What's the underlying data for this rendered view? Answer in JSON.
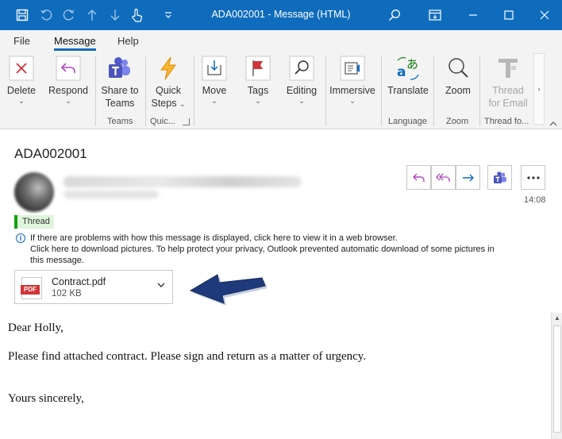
{
  "window": {
    "title": "ADA002001  -  Message (HTML)"
  },
  "menu": {
    "tabs": [
      {
        "label": "File"
      },
      {
        "label": "Message"
      },
      {
        "label": "Help"
      }
    ]
  },
  "ribbon": {
    "buttons": {
      "delete": "Delete",
      "respond": "Respond",
      "share_line1": "Share to",
      "share_line2": "Teams",
      "quick_line1": "Quick",
      "quick_line2": "Steps",
      "move": "Move",
      "tags": "Tags",
      "editing": "Editing",
      "immersive": "Immersive",
      "translate": "Translate",
      "zoom": "Zoom",
      "thread_line1": "Thread",
      "thread_line2": "for Email"
    },
    "groups": {
      "teams": "Teams",
      "quick": "Quic...",
      "language": "Language",
      "zoom": "Zoom",
      "thread": "Thread fo..."
    }
  },
  "message": {
    "subject": "ADA002001",
    "thread_tag": "Thread",
    "time": "14:08",
    "info_line1": "If there are problems with how this message is displayed, click here to view it in a web browser.",
    "info_line2": "Click here to download pictures. To help protect your privacy, Outlook prevented automatic download of some pictures in",
    "info_line3": "this message.",
    "attachment": {
      "icon_text": "PDF",
      "name": "Contract.pdf",
      "size": "102 KB"
    },
    "body": {
      "greeting": "Dear Holly,",
      "line1": "Please find attached contract. Please sign and return as a matter of urgency.",
      "closing": "Yours sincerely,"
    }
  },
  "colors": {
    "accent": "#0f6cbd",
    "annotation_arrow": "#1f3a7a",
    "reply_icons": "#b146c2",
    "teams": "#4b53bc"
  }
}
